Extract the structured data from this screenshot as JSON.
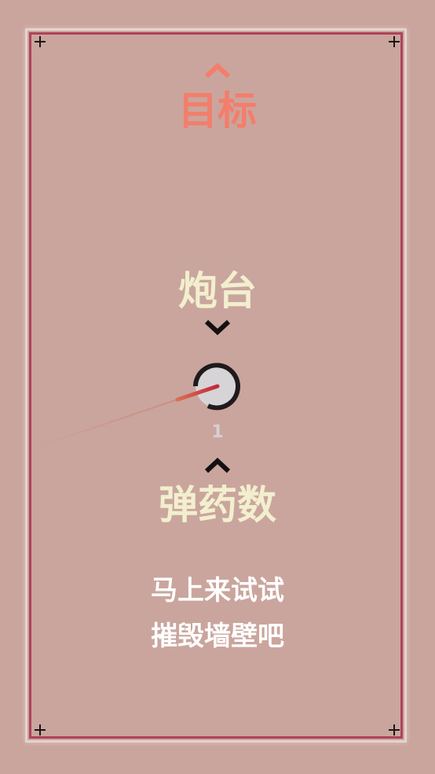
{
  "labels": {
    "target": "目标",
    "turret": "炮台",
    "ammo": "弹药数"
  },
  "ammo_count": "1",
  "hint": {
    "line1": "马上来试试",
    "line2": "摧毁墙壁吧"
  },
  "icons": {
    "target_arrow": "chevron-up-icon",
    "turret_arrow": "chevron-down-icon",
    "ammo_arrow": "chevron-up-icon"
  },
  "colors": {
    "background": "#caa59d",
    "target_text": "#f47d6b",
    "label_text": "#f2efcf",
    "frame_accent": "#b0425a",
    "barrel": "#c8333a"
  }
}
